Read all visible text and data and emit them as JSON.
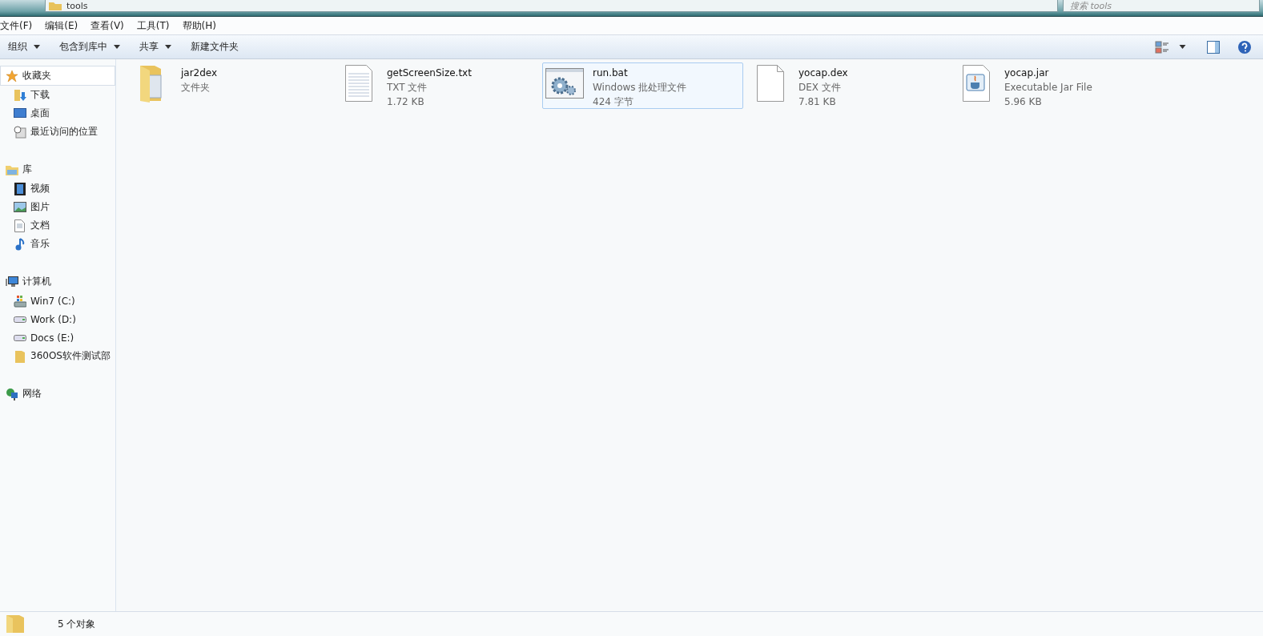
{
  "address_bar": {
    "path": "tools"
  },
  "search": {
    "placeholder": "搜索 tools"
  },
  "menu": [
    "文件(F)",
    "编辑(E)",
    "查看(V)",
    "工具(T)",
    "帮助(H)"
  ],
  "toolbar": [
    {
      "label": "组织",
      "dropdown": true
    },
    {
      "label": "包含到库中",
      "dropdown": true
    },
    {
      "label": "共享",
      "dropdown": true
    },
    {
      "label": "新建文件夹",
      "dropdown": false
    }
  ],
  "sidebar": {
    "groups": [
      {
        "label": "收藏夹",
        "kind": "star",
        "selected": true,
        "children": [
          {
            "label": "下载",
            "kind": "download"
          },
          {
            "label": "桌面",
            "kind": "desktop"
          },
          {
            "label": "最近访问的位置",
            "kind": "recent"
          }
        ]
      },
      {
        "label": "库",
        "kind": "library",
        "selected": false,
        "children": [
          {
            "label": "视频",
            "kind": "video"
          },
          {
            "label": "图片",
            "kind": "picture"
          },
          {
            "label": "文档",
            "kind": "document"
          },
          {
            "label": "音乐",
            "kind": "music"
          }
        ]
      },
      {
        "label": "计算机",
        "kind": "computer",
        "selected": false,
        "children": [
          {
            "label": "Win7 (C:)",
            "kind": "system-drive"
          },
          {
            "label": "Work (D:)",
            "kind": "drive"
          },
          {
            "label": "Docs (E:)",
            "kind": "drive"
          },
          {
            "label": "360OS软件测试部",
            "kind": "folder"
          }
        ]
      },
      {
        "label": "网络",
        "kind": "network",
        "selected": false
      }
    ]
  },
  "files": [
    {
      "name": "jar2dex",
      "type": "文件夹",
      "kind": "folder",
      "selected": false
    },
    {
      "name": "getScreenSize.txt",
      "type": "TXT 文件",
      "size": "1.72 KB",
      "kind": "text",
      "selected": false
    },
    {
      "name": "run.bat",
      "type": "Windows 批处理文件",
      "size": "424 字节",
      "kind": "batch",
      "selected": true
    },
    {
      "name": "yocap.dex",
      "type": "DEX 文件",
      "size": "7.81 KB",
      "kind": "blank",
      "selected": false
    },
    {
      "name": "yocap.jar",
      "type": "Executable Jar File",
      "size": "5.96 KB",
      "kind": "jar",
      "selected": false
    }
  ],
  "status_bar": {
    "count": "5 个对象"
  }
}
